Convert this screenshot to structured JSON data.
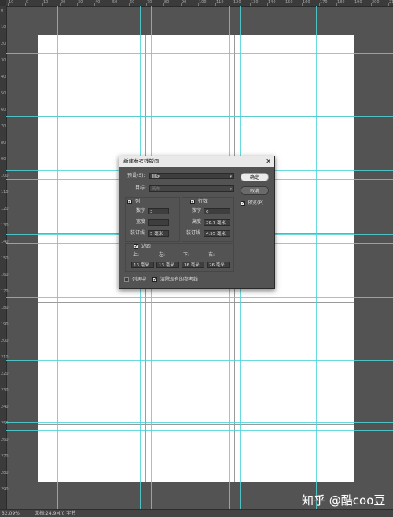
{
  "ruler": {
    "top_labels": [
      "10",
      "0",
      "10",
      "20",
      "30",
      "40",
      "50",
      "60",
      "70",
      "80",
      "90",
      "100",
      "110",
      "120",
      "130",
      "140",
      "150",
      "160",
      "170",
      "180",
      "190",
      "200",
      "210"
    ],
    "left_labels": [
      "0",
      "10",
      "20",
      "30",
      "40",
      "50",
      "60",
      "70",
      "80",
      "90",
      "100",
      "110",
      "120",
      "130",
      "140",
      "150",
      "160",
      "170",
      "180",
      "190",
      "200",
      "210",
      "220",
      "230",
      "240",
      "250",
      "260",
      "270",
      "280",
      "290",
      "300"
    ]
  },
  "status": {
    "zoom": "32.09%",
    "doc": "文档:24.9M/0 字节"
  },
  "watermark": "知乎 @酷coo豆",
  "dialog": {
    "title": "新建参考线版面",
    "close_glyph": "✕",
    "preset_label": "预设(S):",
    "preset_value": "自定",
    "target_label": "目标:",
    "target_value": "画布",
    "columns": {
      "label": "列",
      "number_label": "数字",
      "number_value": "3",
      "width_label": "宽度",
      "width_value": "",
      "gutter_label": "装订线",
      "gutter_value": "5 毫米"
    },
    "rows": {
      "label": "行数",
      "number_label": "数字",
      "number_value": "6",
      "height_label": "高度",
      "height_value": "36.7 毫米",
      "gutter_label": "装订线",
      "gutter_value": "4.55 毫米"
    },
    "margin": {
      "label": "边距",
      "top_label": "上:",
      "top_value": "13 毫米",
      "left_label": "左:",
      "left_value": "13 毫米",
      "bottom_label": "下:",
      "bottom_value": "36 毫米",
      "right_label": "右:",
      "right_value": "26 毫米"
    },
    "center_columns_label": "列居中",
    "clear_guides_label": "清除现有的参考线",
    "ok_label": "确定",
    "cancel_label": "取消",
    "preview_label": "预览(P)",
    "check_glyph": "✔"
  },
  "colors": {
    "guide": "#4fd3d7",
    "workspace": "#535353",
    "dialog_bg": "#535353"
  }
}
